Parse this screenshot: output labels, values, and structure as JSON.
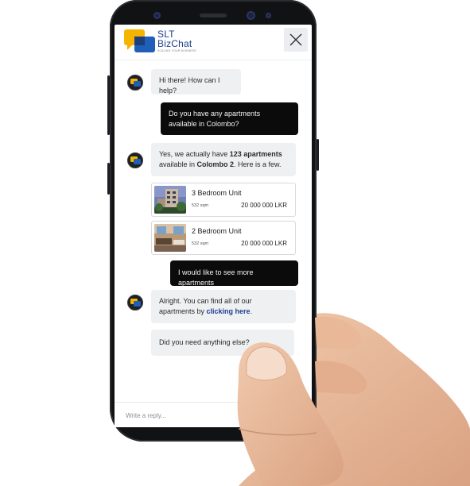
{
  "brand": {
    "name_line1": "SLT",
    "name_line2": "BizChat",
    "tagline": "SCALING YOUR BUSINESS",
    "colors": {
      "primary": "#1d3f8c",
      "accent": "#f5b400",
      "user_bubble": "#0b0b0b",
      "bot_bubble": "#eff0f1"
    }
  },
  "header": {
    "close_icon": "close-icon"
  },
  "messages": {
    "m1": {
      "text": "Hi there! How can I help?"
    },
    "m2": {
      "text": "Do you have any apartments available in Colombo?"
    },
    "m3": {
      "pre": "Yes, we actually have ",
      "count": "123 apartments",
      "mid": " available in ",
      "location": "Colombo 2",
      "post": ". Here is a few."
    },
    "m4": {
      "text": "I would like to see more apartments"
    },
    "m5": {
      "pre": "Alright. You can find all of our apartments by ",
      "link": "clicking here",
      "post": "."
    },
    "m6": {
      "text": "Did you need anything else?"
    }
  },
  "listings": [
    {
      "title": "3 Bedroom Unit",
      "area": "532 sqm",
      "price": "20 000 000 LKR"
    },
    {
      "title": "2 Bedroom Unit",
      "area": "532 sqm",
      "price": "20 000 000 LKR"
    }
  ],
  "composer": {
    "placeholder": "Write a reply..."
  }
}
